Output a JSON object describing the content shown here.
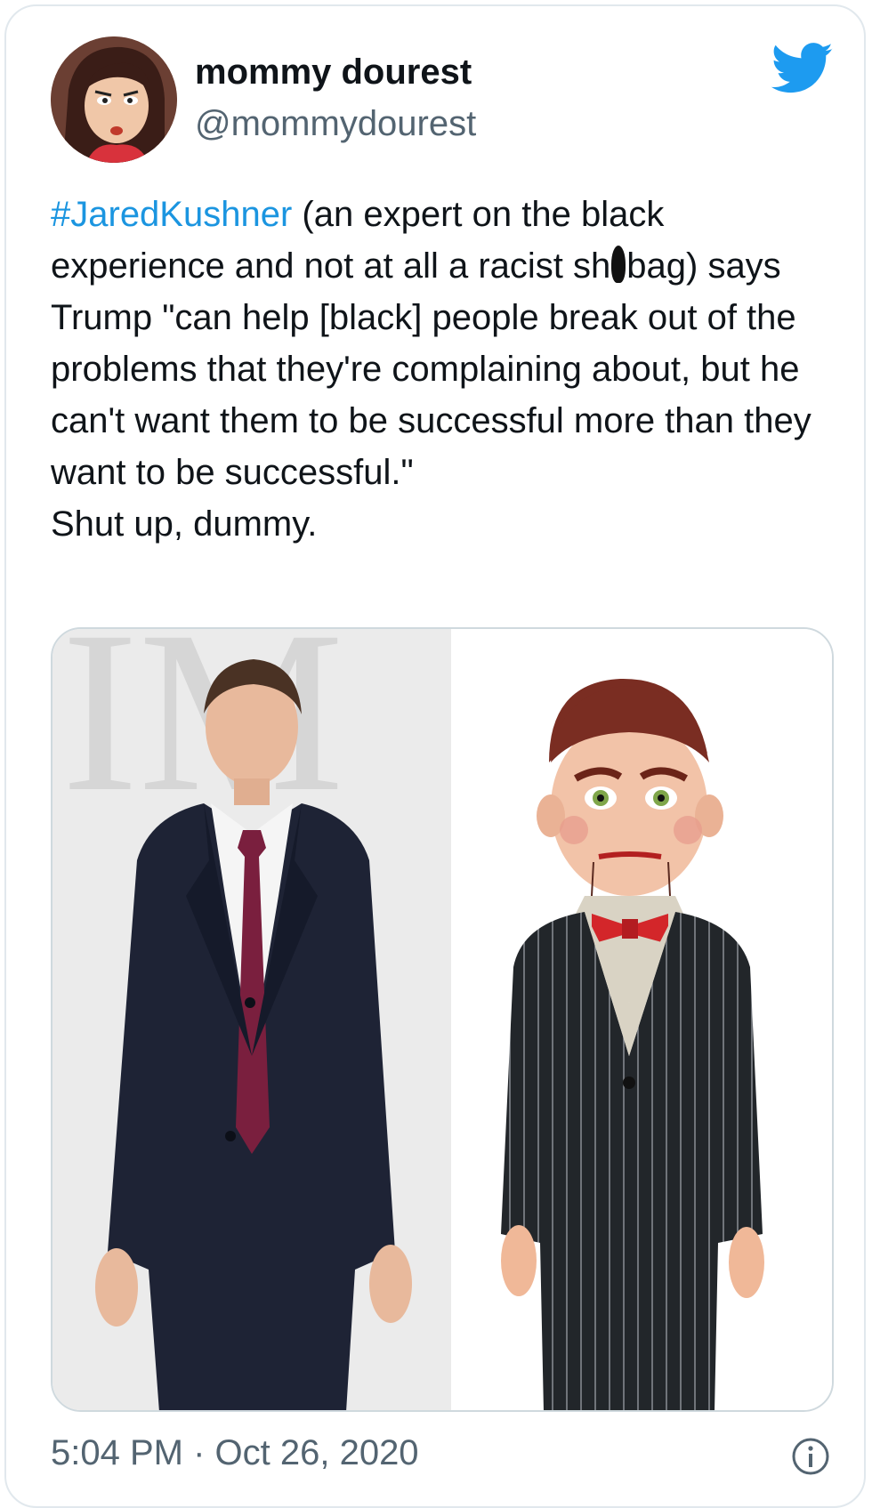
{
  "tweet": {
    "author": {
      "display_name": "mommy dourest",
      "handle": "@mommydourest",
      "avatar_icon": "cartoon-avatar"
    },
    "platform_icon": "twitter-bird-icon",
    "text": {
      "hashtag": "#JaredKushner",
      "after_hashtag": " (an expert on the black experience and not at all a racist sh",
      "after_redaction": "bag) says Trump \"can help [black] people break out of the problems that they're complaining about, but he can't want them to be successful more than they want to be successful.\"",
      "second_line": "Shut up, dummy."
    },
    "media": {
      "left_image": "man-in-suit-photo",
      "right_image": "ventriloquist-dummy-photo"
    },
    "timestamp": "5:04 PM · Oct 26, 2020",
    "info_icon": "info-icon"
  },
  "colors": {
    "link": "#1b95e0",
    "twitter_blue": "#1d9bf0",
    "secondary_text": "#536471",
    "border": "#e1e8ed"
  }
}
